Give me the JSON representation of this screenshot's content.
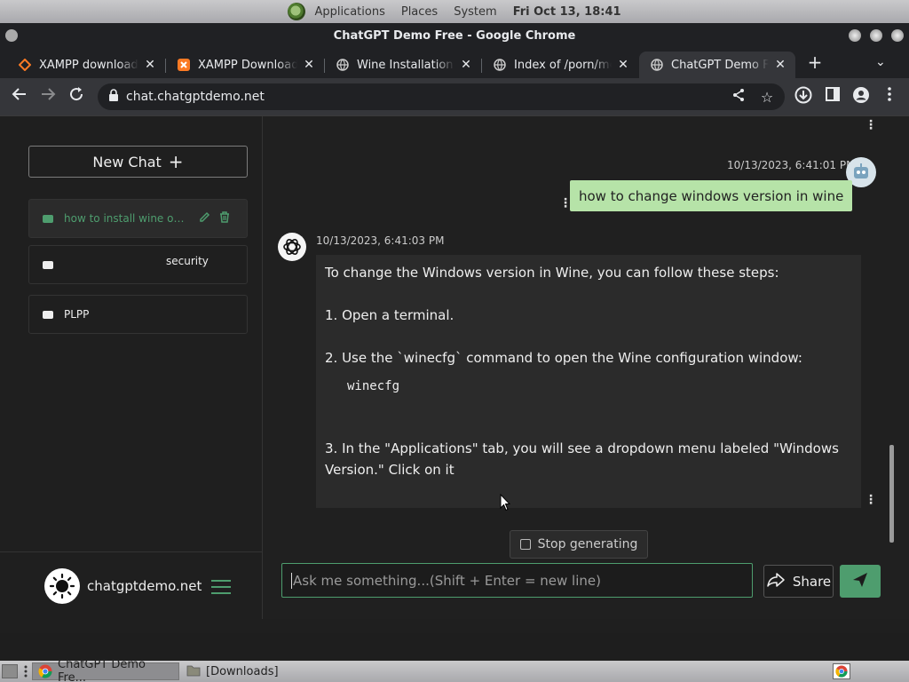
{
  "top_panel": {
    "menus": [
      "Applications",
      "Places",
      "System"
    ],
    "clock": "Fri Oct 13, 18:41"
  },
  "window": {
    "title": "ChatGPT Demo Free - Google Chrome"
  },
  "tabs": [
    {
      "title": "XAMPP download | ",
      "favicon": "xampp-icon"
    },
    {
      "title": "XAMPP Download ",
      "favicon": "xampp-icon"
    },
    {
      "title": "Wine Installation a",
      "favicon": "globe-icon"
    },
    {
      "title": "Index of /porn/med",
      "favicon": "globe-icon"
    },
    {
      "title": "ChatGPT Demo Fre",
      "favicon": "globe-icon",
      "active": true
    }
  ],
  "omnibox": {
    "url": "chat.chatgptdemo.net"
  },
  "sidebar": {
    "new_chat_label": "New Chat",
    "conversations": [
      {
        "title": "how to install wine on ar...",
        "active": true
      },
      {
        "title": "security"
      },
      {
        "title": "PLPP"
      }
    ],
    "brand": "chatgptdemo.net"
  },
  "chat": {
    "user_message": {
      "timestamp": "10/13/2023, 6:41:01 PM",
      "text": "how to change windows version in wine"
    },
    "bot_message": {
      "timestamp": "10/13/2023, 6:41:03 PM",
      "line1": "To change the Windows version in Wine, you can follow these steps:",
      "line2": "1. Open a terminal.",
      "line3": "2. Use the `winecfg` command to open the Wine configuration window:",
      "code": "winecfg",
      "line4": "3. In the \"Applications\" tab, you will see a dropdown menu labeled \"Windows Version.\" Click on it"
    },
    "stop_label": "Stop generating",
    "input_placeholder": "Ask me something...(Shift + Enter = new line)",
    "share_label": "Share"
  },
  "taskbar": {
    "items": [
      "ChatGPT Demo Fre...",
      "[Downloads]"
    ]
  },
  "colors": {
    "accent": "#4e9d6e",
    "user_bubble": "#b6e3a8",
    "bot_bubble": "#2b2b2b"
  }
}
